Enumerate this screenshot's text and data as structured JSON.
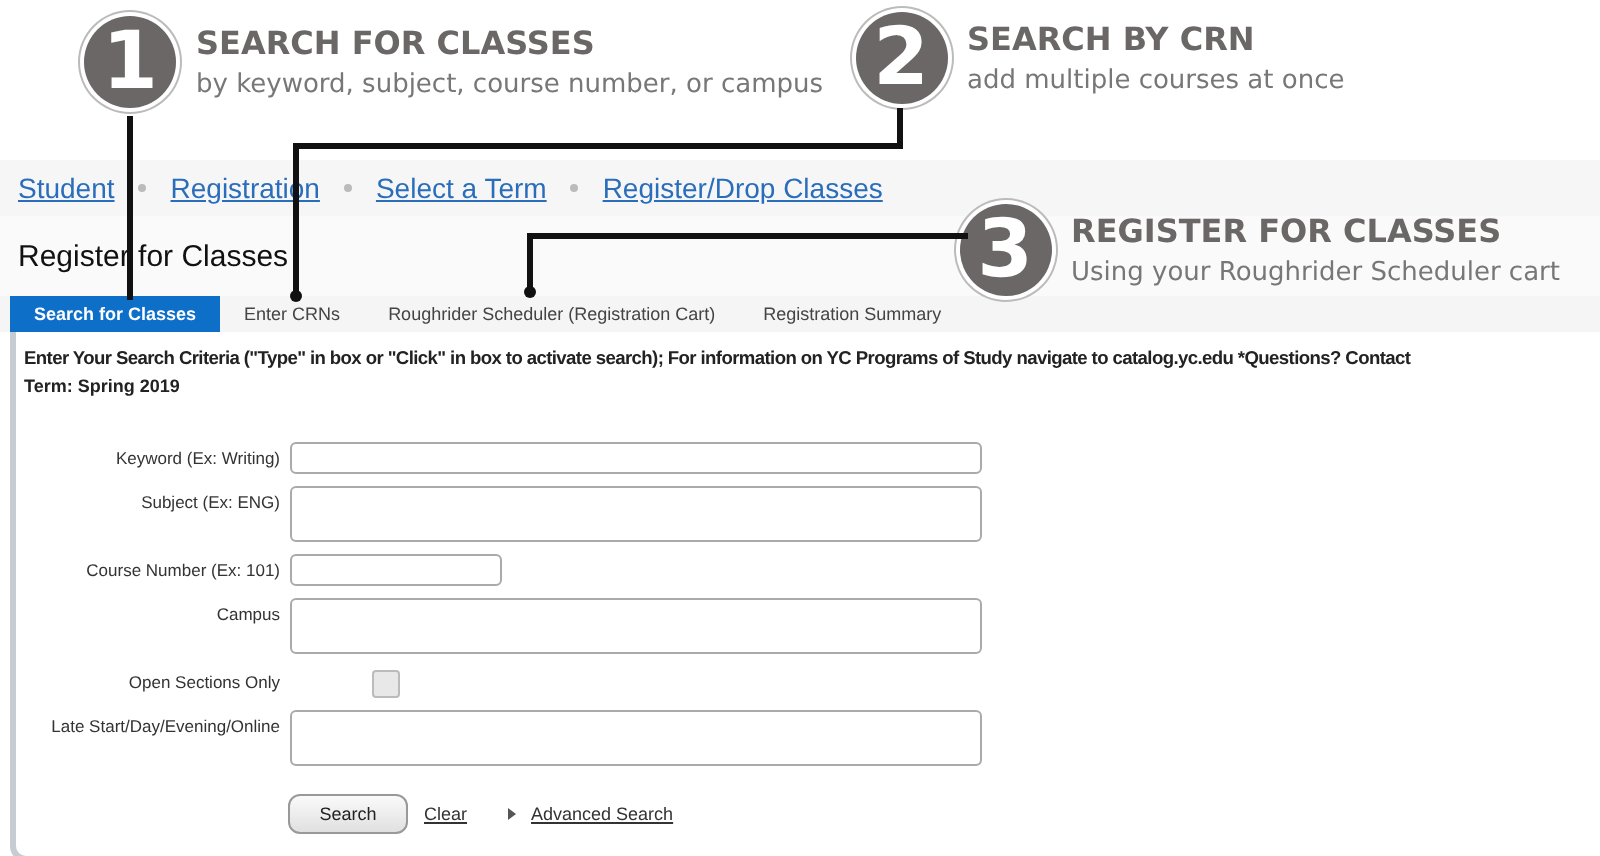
{
  "callouts": [
    {
      "number": "1",
      "title": "SEARCH FOR CLASSES",
      "subtitle": "by keyword,  subject, course number,  or campus"
    },
    {
      "number": "2",
      "title": "SEARCH BY CRN",
      "subtitle": "add multiple courses at once"
    },
    {
      "number": "3",
      "title": "REGISTER FOR CLASSES",
      "subtitle": "Using your Roughrider Scheduler cart"
    }
  ],
  "breadcrumb": [
    {
      "label": "Student"
    },
    {
      "label": "Registration"
    },
    {
      "label": "Select a Term"
    },
    {
      "label": "Register/Drop Classes"
    }
  ],
  "page_title": "Register for Classes",
  "tabs": [
    {
      "label": "Search for Classes",
      "selected": true
    },
    {
      "label": "Enter CRNs",
      "selected": false
    },
    {
      "label": "Roughrider Scheduler (Registration Cart)",
      "selected": false
    },
    {
      "label": "Registration Summary",
      "selected": false
    }
  ],
  "criteria": "Enter Your Search Criteria (\"Type\" in box or \"Click\" in box to activate search); For information on YC Programs of Study navigate to catalog.yc.edu *Questions? Contact",
  "term": "Term: Spring 2019",
  "fields": [
    {
      "label": "Keyword (Ex: Writing)",
      "kind": "text"
    },
    {
      "label": "Subject (Ex: ENG)",
      "kind": "multi"
    },
    {
      "label": "Course Number (Ex: 101)",
      "kind": "short"
    },
    {
      "label": "Campus",
      "kind": "multi"
    },
    {
      "label": "Open Sections Only",
      "kind": "checkbox",
      "checked": false
    },
    {
      "label": "Late Start/Day/Evening/Online",
      "kind": "multi"
    }
  ],
  "actions": {
    "search": "Search",
    "clear": "Clear",
    "advanced": "Advanced Search"
  }
}
